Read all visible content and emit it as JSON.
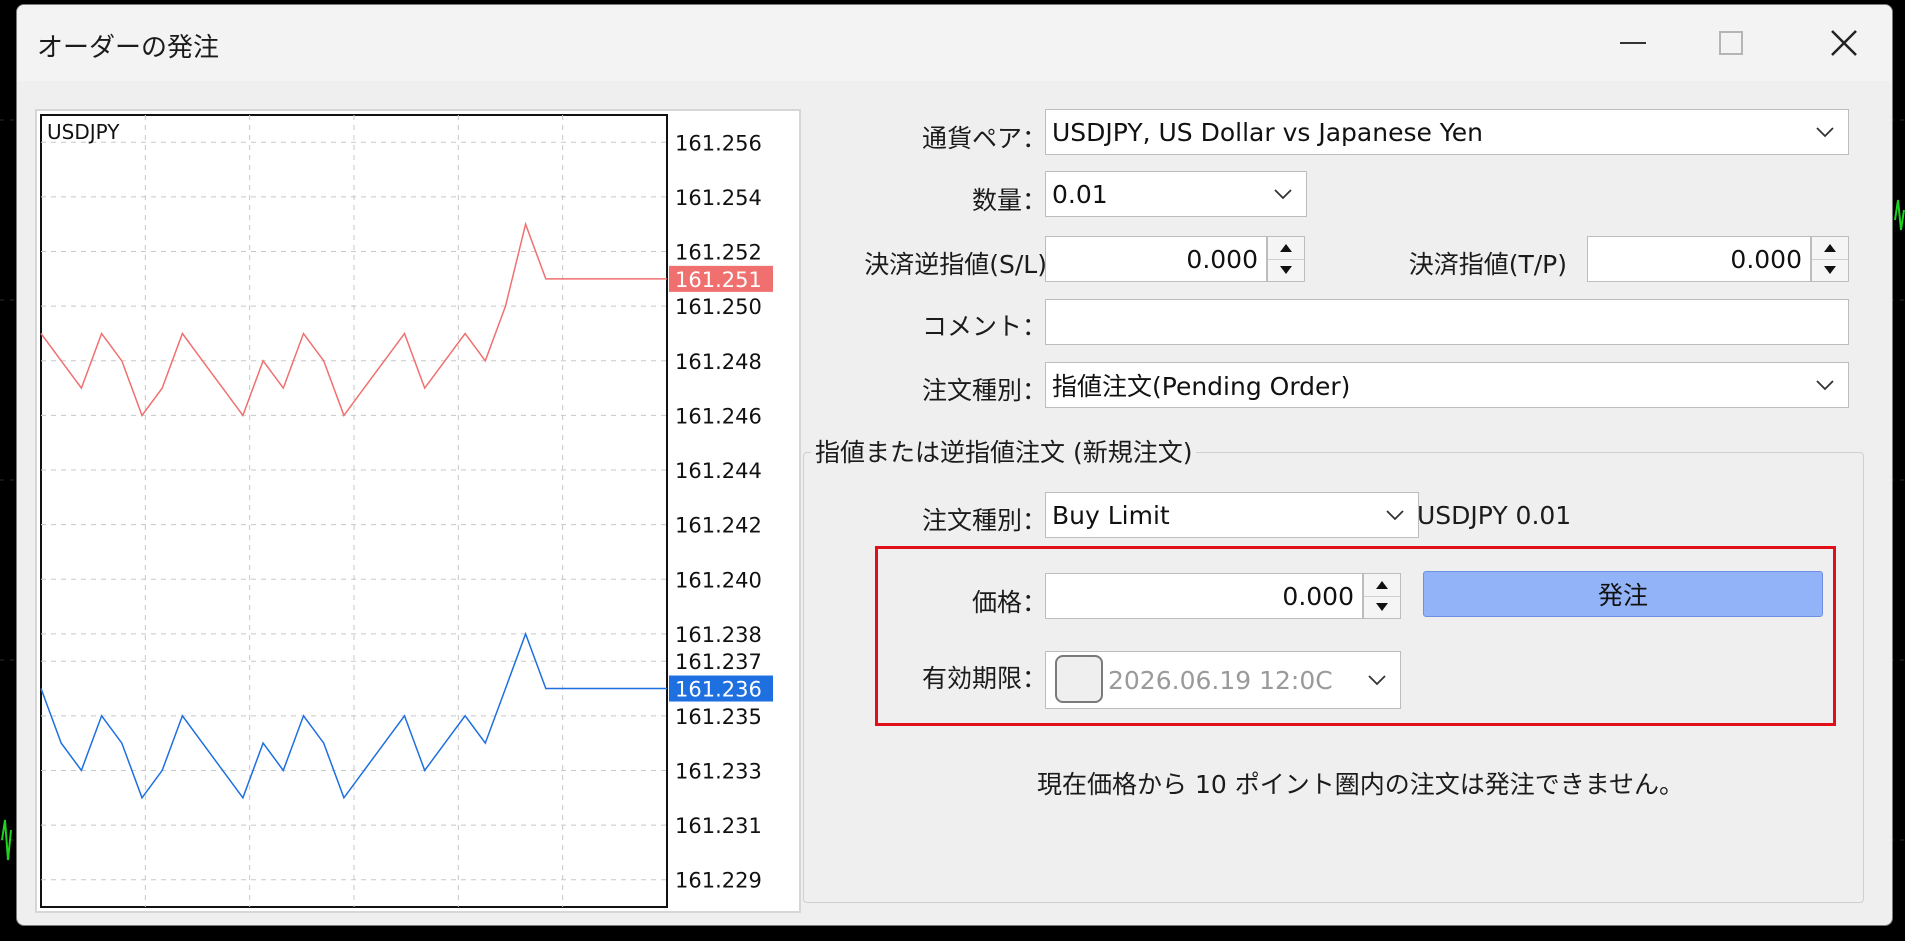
{
  "window": {
    "title": "オーダーの発注",
    "minimize_icon": "minimize-icon",
    "maximize_icon": "maximize-icon",
    "close_icon": "close-icon"
  },
  "chart": {
    "symbol": "USDJPY",
    "price_ticks": [
      "161.256",
      "161.254",
      "161.252",
      "161.250",
      "161.248",
      "161.246",
      "161.244",
      "161.242",
      "161.240",
      "161.238",
      "161.237",
      "161.235",
      "161.233",
      "161.231",
      "161.229"
    ],
    "ask": {
      "value": "161.251",
      "color": "#f07070"
    },
    "bid": {
      "value": "161.236",
      "color": "#1e6fe0"
    }
  },
  "chart_data": {
    "type": "line",
    "title": "USDJPY",
    "ylim": [
      161.228,
      161.257
    ],
    "series": [
      {
        "values": [
          161.249,
          161.248,
          161.247,
          161.249,
          161.248,
          161.246,
          161.247,
          161.249,
          161.248,
          161.247,
          161.246,
          161.248,
          161.247,
          161.249,
          161.248,
          161.246,
          161.247,
          161.248,
          161.249,
          161.247,
          161.248,
          161.249,
          161.248,
          161.25,
          161.253,
          161.251,
          161.251,
          161.251,
          161.251,
          161.251,
          161.251,
          161.251
        ]
      },
      {
        "values": [
          161.236,
          161.234,
          161.233,
          161.235,
          161.234,
          161.232,
          161.233,
          161.235,
          161.234,
          161.233,
          161.232,
          161.234,
          161.233,
          161.235,
          161.234,
          161.232,
          161.233,
          161.234,
          161.235,
          161.233,
          161.234,
          161.235,
          161.234,
          161.236,
          161.238,
          161.236,
          161.236,
          161.236,
          161.236,
          161.236,
          161.236,
          161.236
        ]
      }
    ]
  },
  "form": {
    "currency_pair": {
      "label": "通貨ペア：",
      "value": "USDJPY, US Dollar vs Japanese Yen"
    },
    "volume": {
      "label": "数量：",
      "value": "0.01"
    },
    "stop_loss": {
      "label": "決済逆指値(S/L)",
      "value": "0.000"
    },
    "take_profit": {
      "label": "決済指値(T/P)",
      "value": "0.000"
    },
    "comment": {
      "label": "コメント：",
      "value": ""
    },
    "order_type": {
      "label": "注文種別：",
      "value": "指値注文(Pending Order)"
    }
  },
  "pending_group": {
    "title": "指値または逆指値注文 (新規注文)",
    "type_label": "注文種別：",
    "type_value": "Buy Limit",
    "summary": "USDJPY 0.01",
    "price_label": "価格：",
    "price_value": "0.000",
    "submit_label": "発注",
    "expiry_label": "有効期限：",
    "expiry_value": "2026.06.19 12:0C",
    "note": "現在価格から 10 ポイント圏内の注文は発注できません。"
  },
  "colors": {
    "highlight": "#e0101a",
    "submit": "#93b3f8"
  }
}
